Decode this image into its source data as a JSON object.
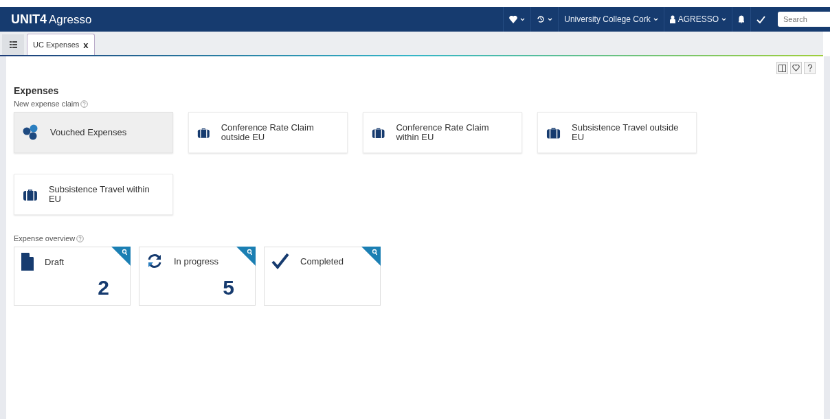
{
  "app": {
    "brand_bold": "UNIT4",
    "brand": "Agresso"
  },
  "topbar": {
    "organisation": "University College Cork",
    "user": "AGRESSO",
    "search": {
      "placeholder": "Search"
    }
  },
  "tabs": [
    {
      "label": "UC Expenses",
      "close": "x",
      "selected": true
    }
  ],
  "page": {
    "title": "Expenses",
    "new_claim_label": "New expense claim",
    "claim_tiles": [
      {
        "label": "Vouched Expenses",
        "kind": "coins",
        "selected": true
      },
      {
        "label": "Conference Rate Claim outside EU",
        "kind": "suitcase",
        "selected": false
      },
      {
        "label": "Conference Rate Claim within EU",
        "kind": "suitcase",
        "selected": false
      },
      {
        "label": "Subsistence Travel outside EU",
        "kind": "suitcase",
        "selected": false
      },
      {
        "label": "Subsistence Travel within EU",
        "kind": "suitcase",
        "selected": false
      }
    ],
    "overview_label": "Expense overview",
    "overview_tiles": [
      {
        "label": "Draft",
        "kind": "document",
        "count": "2"
      },
      {
        "label": "In progress",
        "kind": "refresh",
        "count": "5"
      },
      {
        "label": "Completed",
        "kind": "check"
      }
    ]
  }
}
